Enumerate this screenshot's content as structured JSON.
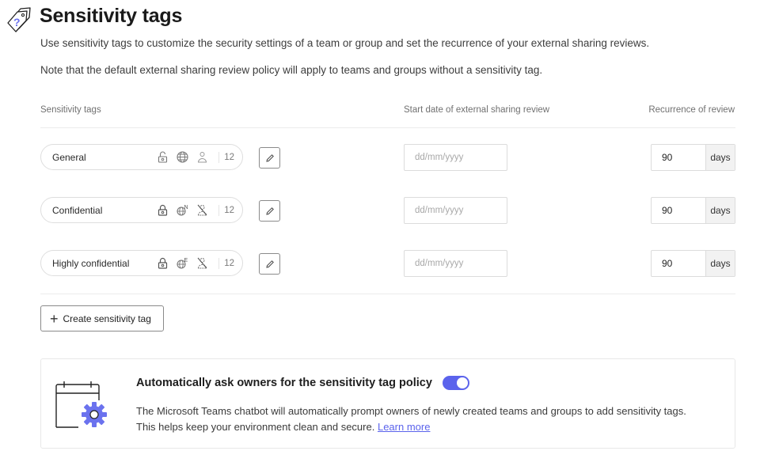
{
  "header": {
    "title": "Sensitivity tags",
    "icon": "tags-question-icon",
    "description": "Use sensitivity tags to customize the security settings of a team or group and set the recurrence of your external sharing reviews.",
    "note": "Note that the default external sharing review policy will apply to teams and groups without a sensitivity tag."
  },
  "table": {
    "columns": {
      "tags": "Sensitivity tags",
      "start_date": "Start date of external sharing review",
      "recurrence": "Recurrence of review"
    },
    "rows": [
      {
        "name": "General",
        "icons": [
          "unlocked-icon",
          "globe-icon",
          "guest-user-icon"
        ],
        "count": "12",
        "date_placeholder": "dd/mm/yyyy",
        "date_value": "",
        "recurrence_value": "90",
        "recurrence_unit": "days"
      },
      {
        "name": "Confidential",
        "icons": [
          "locked-icon",
          "globe-n-icon",
          "no-guest-icon"
        ],
        "count": "12",
        "date_placeholder": "dd/mm/yyyy",
        "date_value": "",
        "recurrence_value": "90",
        "recurrence_unit": "days"
      },
      {
        "name": "Highly confidential",
        "icons": [
          "locked-icon",
          "globe-e-icon",
          "no-guest-icon"
        ],
        "count": "12",
        "date_placeholder": "dd/mm/yyyy",
        "date_value": "",
        "recurrence_value": "90",
        "recurrence_unit": "days"
      }
    ]
  },
  "create_button": {
    "label": "Create sensitivity tag",
    "icon": "plus-icon"
  },
  "policy_card": {
    "title": "Automatically ask owners for the sensitivity tag policy",
    "toggle_on": true,
    "body_line1": "The Microsoft Teams chatbot will automatically prompt owners of newly created teams and groups to add sensitivity tags.",
    "body_line2": "This helps keep your environment clean and secure.",
    "link": "Learn more",
    "accent_color": "#5b63ec"
  }
}
